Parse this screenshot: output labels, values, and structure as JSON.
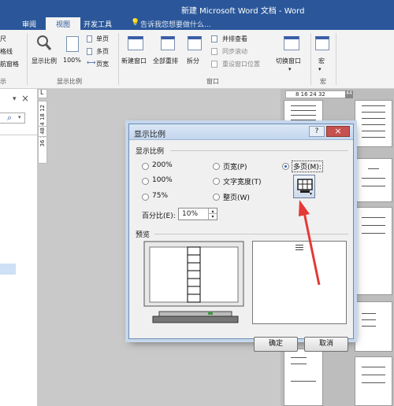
{
  "window": {
    "title": "新建 Microsoft Word 文档 - Word"
  },
  "tabs": [
    "审阅",
    "视图",
    "开发工具"
  ],
  "tell_me": {
    "placeholder": "告诉我您想要做什么..."
  },
  "ribbon": {
    "left_items": [
      "尺",
      "格线",
      "航窗格"
    ],
    "left_group": "示",
    "zoom": {
      "zoom_label": "显示比例",
      "pct_label": "100%",
      "one_page": "单页",
      "multi_page": "多页",
      "page_width": "页宽",
      "group": "显示比例"
    },
    "window": {
      "new_window": "新建窗口",
      "arrange_all": "全部重排",
      "split": "拆分",
      "side_by_side": "并排查看",
      "sync_scroll": "同步滚动",
      "reset_position": "重设窗口位置",
      "switch_windows": "切换窗口",
      "group": "窗口"
    },
    "macros": {
      "label": "宏",
      "group": "宏"
    }
  },
  "nav": {
    "close": "×",
    "search_icon": "⌕"
  },
  "ruler": {
    "vertical_ticks": "36 30 24 18 12",
    "bottom_num": "48",
    "horizontal_ticks": "8 16 24 32",
    "right_num": "44"
  },
  "dialog": {
    "title": "显示比例",
    "help": "?",
    "close": "×",
    "zoom_group": "显示比例",
    "options": [
      {
        "label": "200%",
        "selected": false
      },
      {
        "label": "100%",
        "selected": false
      },
      {
        "label": "75%",
        "selected": false
      },
      {
        "label": "页宽(P)",
        "selected": false
      },
      {
        "label": "文字宽度(T)",
        "selected": false
      },
      {
        "label": "整页(W)",
        "selected": false
      },
      {
        "label": "多页(M):",
        "selected": true
      }
    ],
    "percent_label": "百分比(E):",
    "percent_value": "10%",
    "preview_group": "预览",
    "ok": "确定",
    "cancel": "取消"
  },
  "colors": {
    "word_blue": "#2b579a",
    "arrow_red": "#e53935",
    "dialog_bg": "#f0f0f0"
  }
}
